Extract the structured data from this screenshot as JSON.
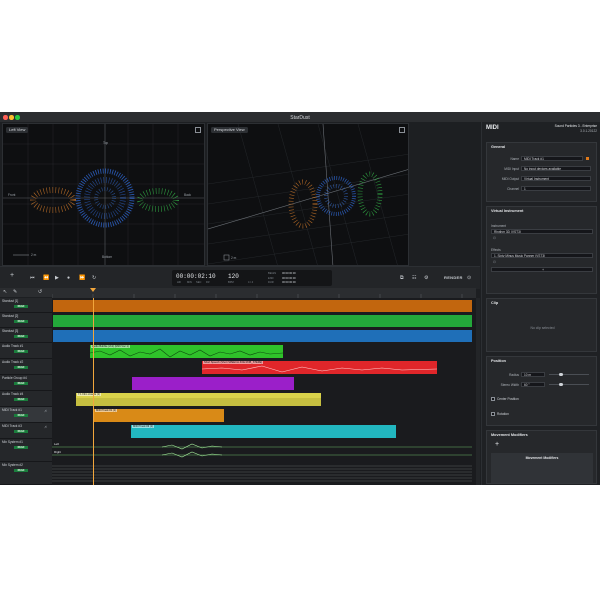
{
  "window": {
    "title": "StarDust"
  },
  "viewports": {
    "left": {
      "view": "Left View",
      "top": "Top",
      "bottom": "Bottom",
      "front": "Front",
      "back": "Back",
      "scale": "2 m"
    },
    "right": {
      "view": "Perspective View",
      "scale": "2 m"
    }
  },
  "transport": {
    "time": "00:00:02:10",
    "time_units": [
      "HR",
      "MIN",
      "SEC",
      "FR"
    ],
    "tempo": "120",
    "tempo_unit": "BPM",
    "sig": "4 / 4",
    "begin_label": "BEGIN",
    "begin": "00:00:00:00",
    "end_label": "END",
    "end": "00:00:00:00",
    "dur_label": "DUR",
    "dur": "00:00:00:00",
    "render": "RENDER"
  },
  "tracks": [
    {
      "name": "Stardust [1]",
      "mode": "READ"
    },
    {
      "name": "Stardust [2]",
      "mode": "READ"
    },
    {
      "name": "Stardust [3]",
      "mode": "READ"
    },
    {
      "name": "Audio Track #1",
      "mode": "READ"
    },
    {
      "name": "Audio Track #2",
      "mode": "READ"
    },
    {
      "name": "Particle Group #4",
      "mode": "READ"
    },
    {
      "name": "Audio Track #4",
      "mode": "READ"
    },
    {
      "name": "MIDI Track #1",
      "mode": "READ"
    },
    {
      "name": "MIDI Track #3",
      "mode": "READ"
    },
    {
      "name": "Mix System #1",
      "mode": "READ"
    },
    {
      "name": "Mix System #2",
      "mode": "READ"
    }
  ],
  "clips": {
    "audio1": "Audio Bubble (ch1) (M16 Voc 1)",
    "audio2": "Short Speech (Short SPEECH ZOE ROB_STERE)",
    "audio4": "7.1 Film crowds (1)",
    "midi1": "MIDI Track #1 (1)",
    "midi3": "MIDI Track #3 (1)",
    "left": "Left",
    "right": "Right"
  },
  "panel": {
    "header": "MIDI",
    "product": "Sound Particles 3 - Enterprise",
    "version": "3.0.1.20122",
    "general": {
      "title": "General",
      "name_label": "Name",
      "name": "MIDI Track #1",
      "input_label": "MIDI Input",
      "input": "No input devices available",
      "output_label": "MIDI Output",
      "output": "Virtual Instrument",
      "channel_label": "Channel",
      "channel": "1"
    },
    "instrument": {
      "title": "Virtual Instrument",
      "instrument_label": "Instrument",
      "instrument": "Rhythm 3D (VST3)",
      "effects_label": "Effects",
      "effect": "1. Sixty Minus Music Panner (VST3)",
      "add": "+"
    },
    "clip": {
      "title": "Clip",
      "empty": "No clip selected"
    },
    "position": {
      "title": "Position",
      "radius_label": "Radius",
      "radius": "10 m",
      "width_label": "Stereo Width",
      "width": "60 °",
      "center": "Center Position",
      "rotation": "Rotation"
    },
    "modifiers": {
      "title": "Movement Modifiers",
      "add": "+",
      "list_title": "Movement Modifiers"
    }
  },
  "colors": {
    "stardust1": "#c2660e",
    "stardust2": "#23a83a",
    "stardust3": "#1f6fb8",
    "audio1": "#2fc22a",
    "audio2": "#e0262a",
    "particle": "#9b1fc9",
    "audio4": "#d9d24a",
    "midi1": "#d98a17",
    "midi3": "#22b7c0",
    "readBtn": "#1b7d3d"
  }
}
